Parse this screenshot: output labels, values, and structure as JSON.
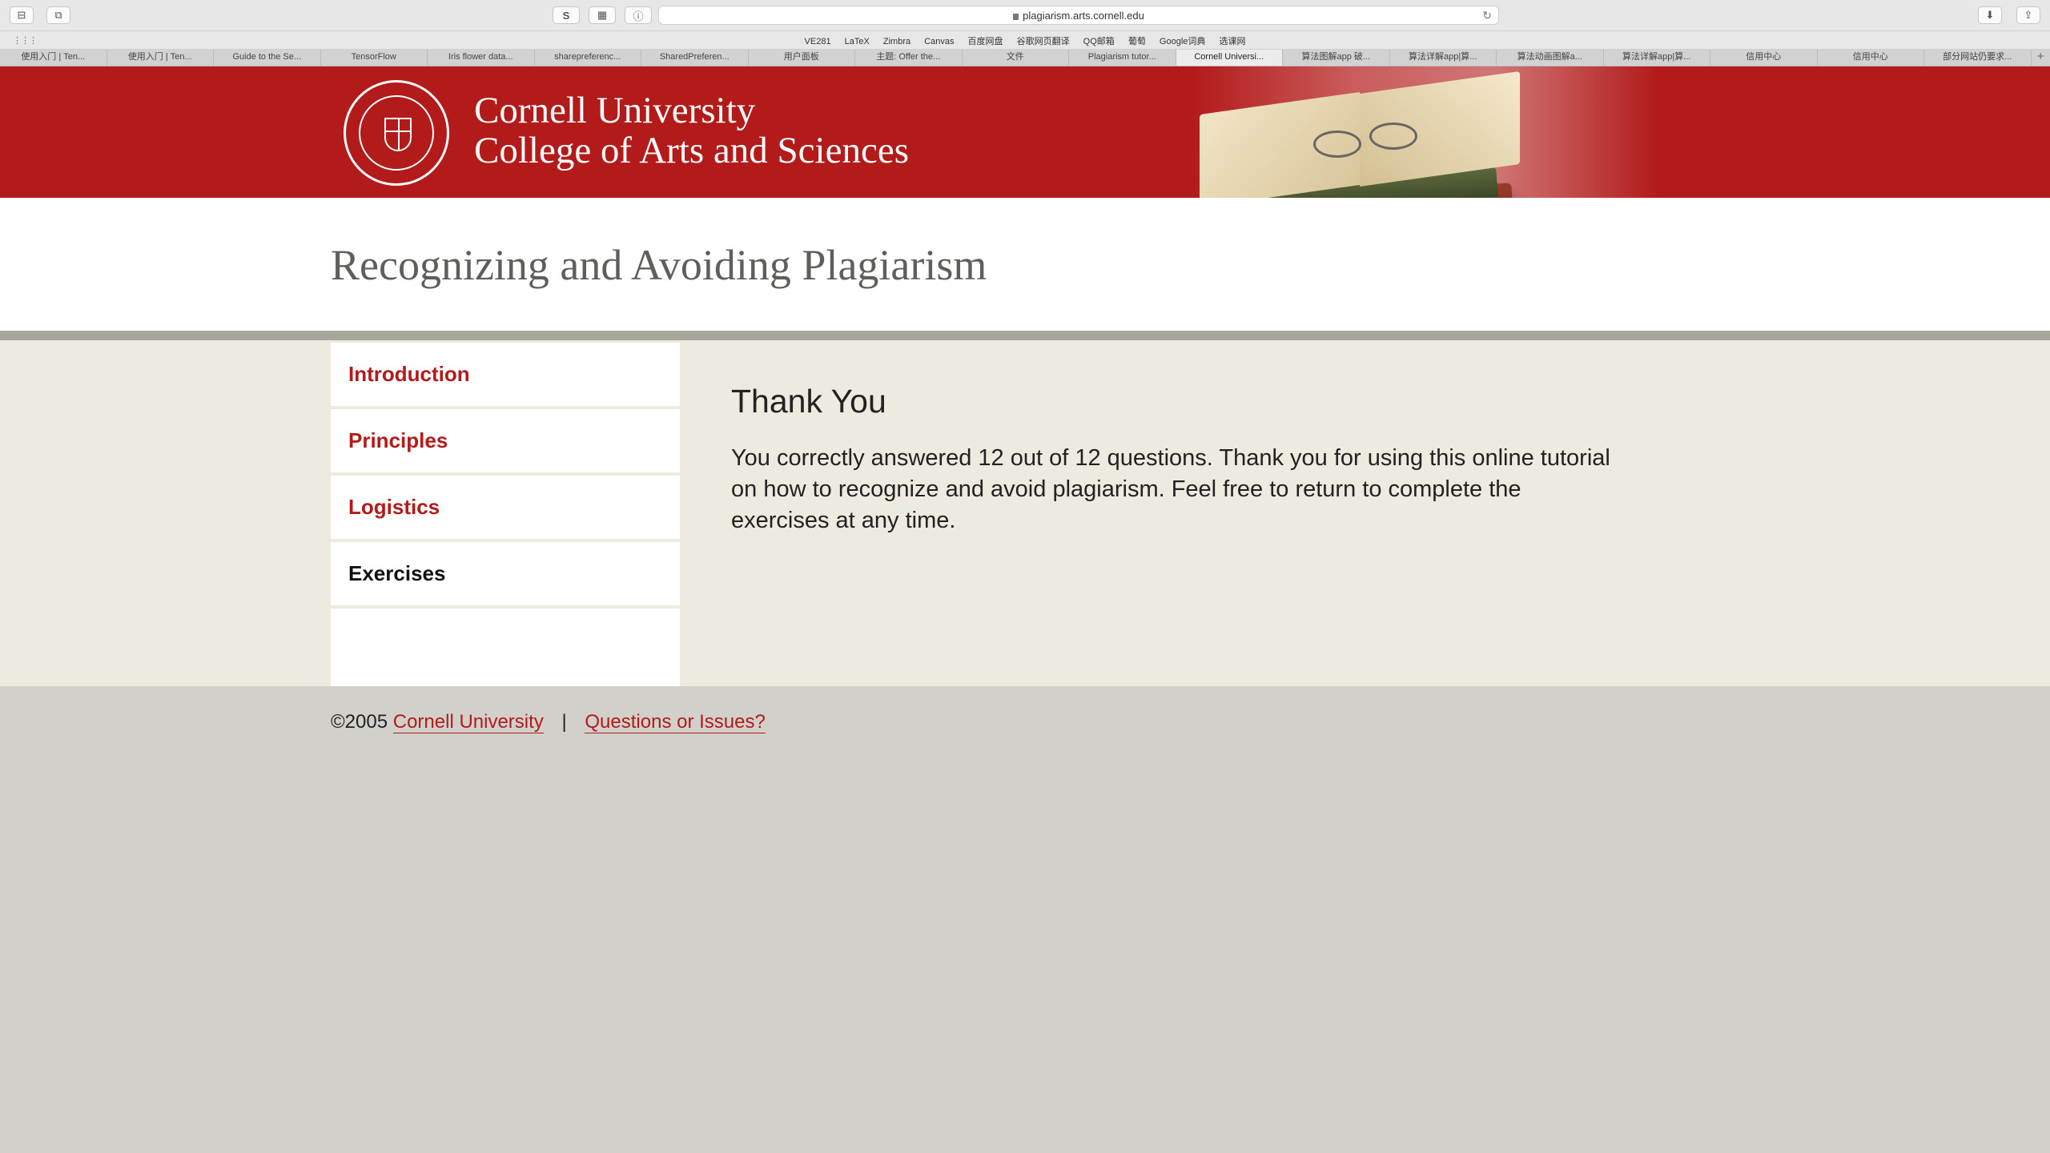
{
  "browser": {
    "url": "plagiarism.arts.cornell.edu",
    "toolbar_left": [
      "⊟",
      "⧉"
    ],
    "toolbar_mid": [
      "S",
      "▦",
      "ⓘ"
    ],
    "favorites": [
      "VE281",
      "LaTeX",
      "Zimbra",
      "Canvas",
      "百度网盘",
      "谷歌网页翻译",
      "QQ邮箱",
      "葡萄",
      "Google词典",
      "选课网"
    ],
    "tabs": [
      {
        "label": "使用入门 | Ten..."
      },
      {
        "label": "使用入门 | Ten..."
      },
      {
        "label": "Guide to the Se..."
      },
      {
        "label": "TensorFlow"
      },
      {
        "label": "Iris flower data..."
      },
      {
        "label": "sharepreferenc..."
      },
      {
        "label": "SharedPreferen..."
      },
      {
        "label": "用户面板"
      },
      {
        "label": "主题: Offer the..."
      },
      {
        "label": "文件"
      },
      {
        "label": "Plagiarism tutor..."
      },
      {
        "label": "Cornell Universi..."
      },
      {
        "label": "算法图解app 破..."
      },
      {
        "label": "算法详解app|算..."
      },
      {
        "label": "算法动画图解a..."
      },
      {
        "label": "算法详解app|算..."
      },
      {
        "label": "信用中心"
      },
      {
        "label": "信用中心"
      },
      {
        "label": "部分网站仍要求..."
      }
    ]
  },
  "header": {
    "university": "Cornell University",
    "college": "College of Arts and Sciences",
    "page_title": "Recognizing and Avoiding Plagiarism"
  },
  "nav": [
    {
      "label": "Introduction"
    },
    {
      "label": "Principles"
    },
    {
      "label": "Logistics"
    },
    {
      "label": "Exercises"
    }
  ],
  "main": {
    "heading": "Thank You",
    "body": "You correctly answered 12 out of 12 questions. Thank you for using this online tutorial on how to recognize and avoid plagiarism. Feel free to return to complete the exercises at any time."
  },
  "footer": {
    "copyright": "©2005",
    "university_link": "Cornell University",
    "separator": "|",
    "issues_link": "Questions or Issues?"
  },
  "colors": {
    "cornell_red": "#b31b1b",
    "content_bg": "#edebe0",
    "footer_bg": "#d1d0cb"
  }
}
